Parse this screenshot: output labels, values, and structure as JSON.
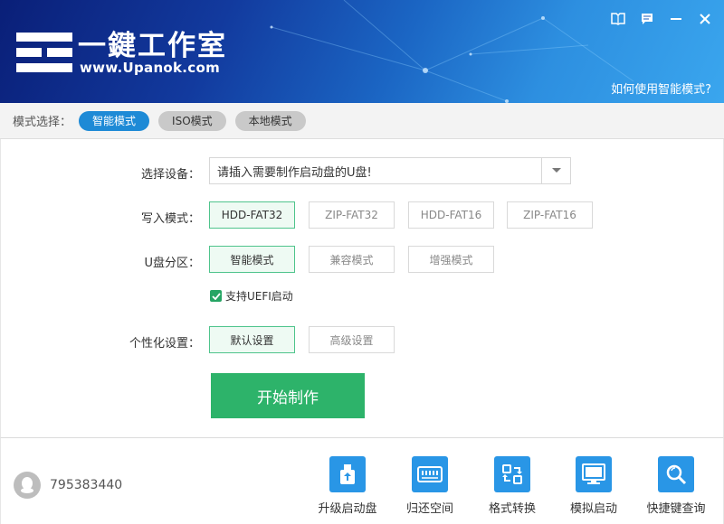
{
  "header": {
    "logo_text": "一鍵工作室",
    "logo_url": "www.Upanok.com",
    "help_link": "如何使用智能模式?",
    "window_icons": [
      "book-icon",
      "feedback-icon",
      "minimize-icon",
      "close-icon"
    ]
  },
  "mode_bar": {
    "label": "模式选择：",
    "tabs": [
      {
        "label": "智能模式",
        "active": true
      },
      {
        "label": "ISO模式",
        "active": false
      },
      {
        "label": "本地模式",
        "active": false
      }
    ]
  },
  "form": {
    "device": {
      "label": "选择设备：",
      "value": "请插入需要制作启动盘的U盘!"
    },
    "write_mode": {
      "label": "写入模式：",
      "options": [
        "HDD-FAT32",
        "ZIP-FAT32",
        "HDD-FAT16",
        "ZIP-FAT16"
      ],
      "selected": "HDD-FAT32"
    },
    "partition": {
      "label": "U盘分区：",
      "options": [
        "智能模式",
        "兼容模式",
        "增强模式"
      ],
      "selected": "智能模式"
    },
    "uefi": {
      "label": "支持UEFI启动",
      "checked": true
    },
    "personalize": {
      "label": "个性化设置：",
      "options": [
        "默认设置",
        "高级设置"
      ],
      "selected": "默认设置"
    },
    "start_button": "开始制作"
  },
  "footer": {
    "qq_number": "795383440",
    "tools": [
      {
        "label": "升级启动盘",
        "icon": "upgrade-icon"
      },
      {
        "label": "归还空间",
        "icon": "storage-icon"
      },
      {
        "label": "格式转换",
        "icon": "convert-icon"
      },
      {
        "label": "模拟启动",
        "icon": "monitor-icon"
      },
      {
        "label": "快捷键查询",
        "icon": "search-icon"
      }
    ]
  },
  "colors": {
    "accent_blue": "#1e8ad6",
    "start_green": "#2db36a",
    "selected_border": "#4fc48c",
    "tool_icon_blue": "#2996e6"
  }
}
